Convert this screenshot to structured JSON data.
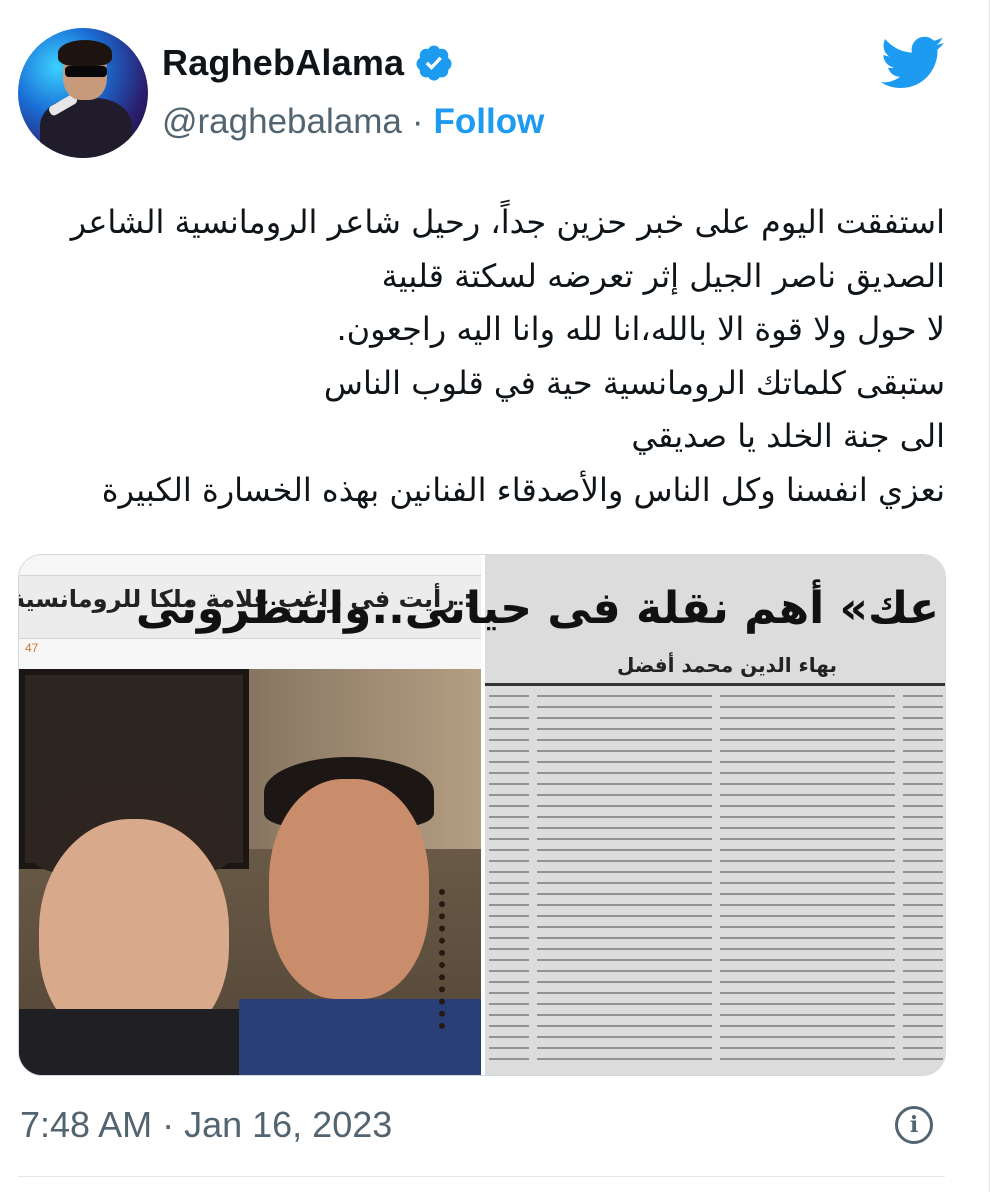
{
  "author": {
    "display_name": "RaghebAlama",
    "handle": "@raghebalama",
    "separator": "·",
    "follow_label": "Follow",
    "verified": true
  },
  "tweet": {
    "lines": [
      "استفقت اليوم على خبر حزين جداً، رحيل شاعر الرومانسية الشاعر",
      "الصديق ناصر الجيل إثر تعرضه لسكتة قلبية",
      "لا حول ولا قوة الا بالله،انا لله وانا اليه راجعون.",
      "ستبقى كلماتك الرومانسية حية في قلوب الناس",
      "الى جنة الخلد يا صديقي",
      "نعزي انفسنا وكل الناس والأصدقاء الفنانين بهذه الخسارة الكبيرة"
    ]
  },
  "media": {
    "left": {
      "headline": ": رأيت فى راغب علامة ملكا للرومانسية",
      "meta": "47"
    },
    "right": {
      "headline": "عك» أهم نقلة فى حياتى..وانتظرونى",
      "byline": "بهاء الدين محمد أفضل"
    }
  },
  "footer": {
    "timestamp": "7:48 AM · Jan 16, 2023",
    "info_icon": "i"
  },
  "colors": {
    "accent": "#1d9bf0",
    "muted": "#536471",
    "text": "#0f1419"
  }
}
